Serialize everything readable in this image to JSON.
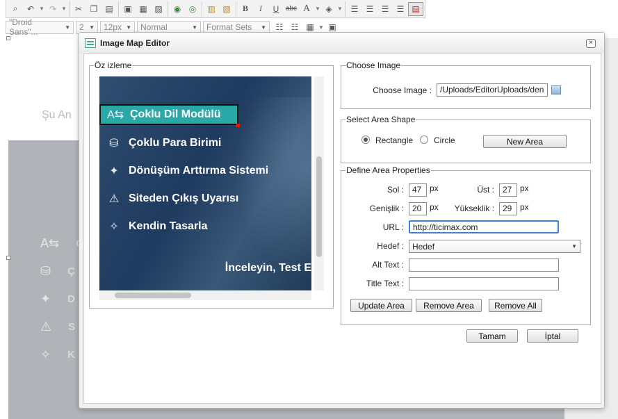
{
  "toolbar": {
    "font_family": "\"Droid Sans\"...",
    "font_size_num": "2",
    "font_size_px": "12px",
    "block_format": "Normal",
    "format_sets": "Format Sets",
    "icons": [
      "find-icon",
      "undo-icon",
      "redo-icon",
      "cut-icon",
      "copy-icon",
      "paste-icon",
      "image-icon",
      "image-map-icon",
      "image-edit-icon",
      "link-icon",
      "unlink-icon",
      "paste-text-icon",
      "paste-word-icon",
      "bold-icon",
      "italic-icon",
      "underline-icon",
      "strikethrough-icon",
      "font-color-icon",
      "highlight-icon",
      "align-left-icon",
      "align-center-icon",
      "align-right-icon",
      "justify-icon",
      "source-icon"
    ],
    "glyphs": {
      "bold": "B",
      "italic": "I",
      "underline": "U",
      "strike": "abc",
      "font_color": "A"
    }
  },
  "background": {
    "partial_text": "Şu An",
    "items": [
      {
        "icon": "language-icon",
        "letter": "Ç"
      },
      {
        "icon": "coins-icon",
        "letter": "Ç"
      },
      {
        "icon": "rocket-icon",
        "letter": "D"
      },
      {
        "icon": "warning-icon",
        "letter": "S"
      },
      {
        "icon": "magic-wand-icon",
        "letter": "K"
      }
    ]
  },
  "dialog": {
    "title": "Image Map Editor",
    "close_glyph": "×",
    "preview": {
      "legend": "Öz izleme",
      "menu_items": [
        {
          "icon": "language-icon",
          "glyph": "A⇆",
          "label": "Çoklu Dil Modülü",
          "highlighted": true
        },
        {
          "icon": "coins-icon",
          "glyph": "⛁",
          "label": "Çoklu Para Birimi"
        },
        {
          "icon": "rocket-icon",
          "glyph": "✦",
          "label": "Dönüşüm Arttırma Sistemi"
        },
        {
          "icon": "warning-icon",
          "glyph": "⚠",
          "label": "Siteden Çıkış Uyarısı"
        },
        {
          "icon": "magic-wand-icon",
          "glyph": "✧",
          "label": "Kendin Tasarla"
        }
      ],
      "cta": "İnceleyin, Test E"
    },
    "choose_image": {
      "legend": "Choose Image",
      "label": "Choose Image :",
      "value": "/Uploads/EditorUploads/den"
    },
    "shape": {
      "legend": "Select Area Shape",
      "options": [
        "Rectangle",
        "Circle"
      ],
      "selected": "Rectangle",
      "new_area": "New Area"
    },
    "props": {
      "legend": "Define Area Properties",
      "sol_label": "Sol :",
      "sol": "47",
      "ust_label": "Üst :",
      "ust": "27",
      "genislik_label": "Genişlik :",
      "genislik": "20",
      "yukseklik_label": "Yükseklik :",
      "yukseklik": "29",
      "unit": "px",
      "url_label": "URL :",
      "url": "http://ticimax.com",
      "hedef_label": "Hedef :",
      "hedef": "Hedef",
      "alt_label": "Alt Text :",
      "alt": "",
      "title_label": "Title Text :",
      "title": "",
      "update": "Update Area",
      "remove": "Remove Area",
      "remove_all": "Remove All"
    },
    "ok": "Tamam",
    "cancel": "İptal"
  }
}
